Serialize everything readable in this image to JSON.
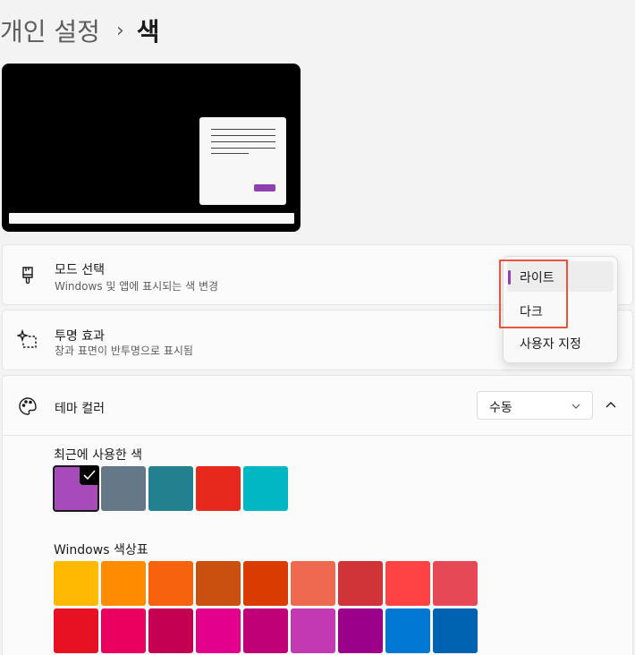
{
  "breadcrumb": {
    "parent": "개인 설정",
    "separator": "›",
    "current": "색"
  },
  "mode_row": {
    "title": "모드 선택",
    "description": "Windows 및 앱에 표시되는 색 변경",
    "icon": "paintbrush-icon"
  },
  "transparency_row": {
    "title": "투명 효과",
    "description": "창과 표면이 반투명으로 표시됨",
    "icon": "sparkle-selection-icon"
  },
  "theme_color_row": {
    "title": "테마 컬러",
    "icon": "palette-icon",
    "dropdown_value": "수동"
  },
  "mode_popup": {
    "items": [
      {
        "label": "라이트",
        "selected": true
      },
      {
        "label": "다크",
        "selected": false
      },
      {
        "label": "사용자 지정",
        "selected": false
      }
    ]
  },
  "recent_colors": {
    "label": "최근에 사용한 색",
    "colors": [
      "#a64bb9",
      "#647887",
      "#23808f",
      "#e7281d",
      "#00b7c3"
    ],
    "selected_index": 0
  },
  "windows_palette": {
    "label": "Windows 색상표",
    "rows": [
      [
        "#ffb900",
        "#ff8c00",
        "#f7630c",
        "#ca5010",
        "#da3b01",
        "#ef6950",
        "#d13438",
        "#ff4343",
        "#e74856"
      ],
      [
        "#e81123",
        "#ea005e",
        "#c30052",
        "#e3008c",
        "#bf0077",
        "#c239b3",
        "#9a0089",
        "#0078d4",
        "#0063b1"
      ]
    ]
  },
  "preview_accent": "#8f3fae"
}
